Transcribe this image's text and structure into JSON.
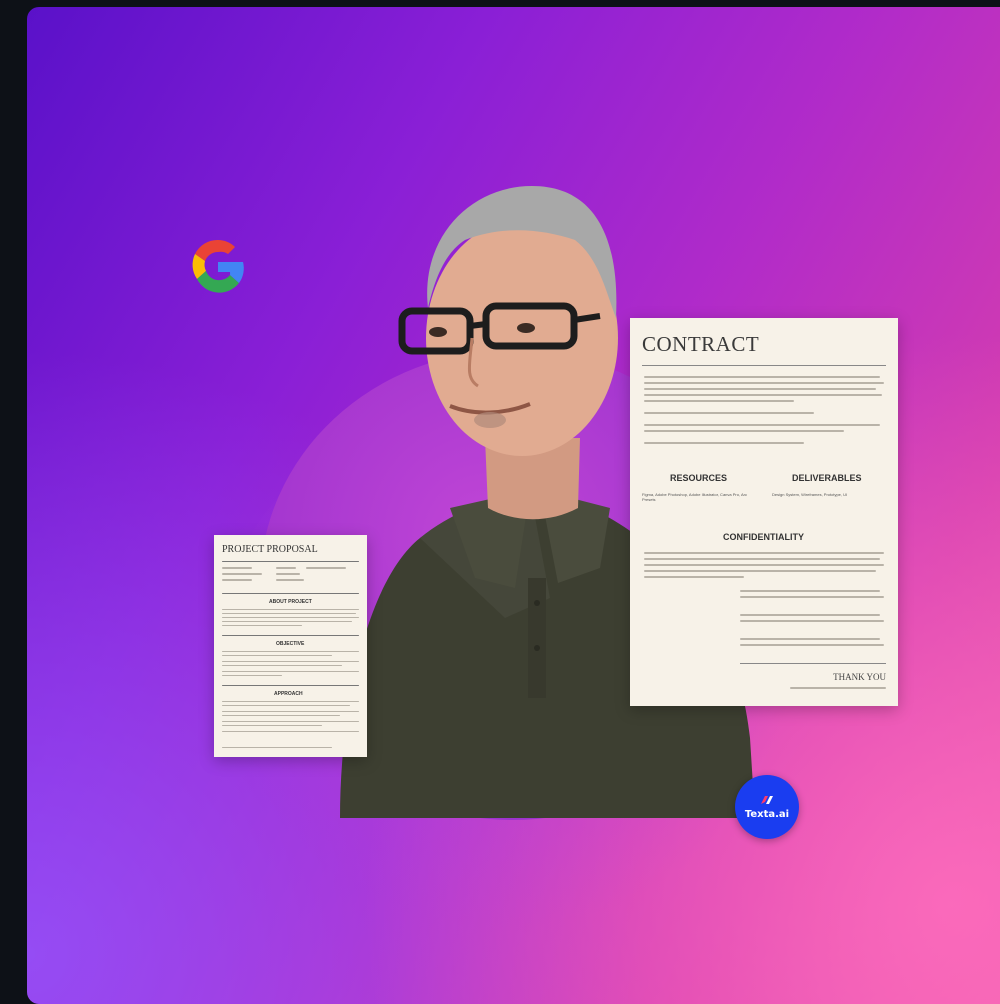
{
  "contract": {
    "title": "CONTRACT",
    "resources_heading": "RESOURCES",
    "resources_text": "Figma, Adobe Photoshop, Adobe Illustrator, Canva Pro, Arc Presets",
    "deliverables_heading": "DELIVERABLES",
    "deliverables_text": "Design System, Wireframes, Prototype, UI",
    "confidentiality_heading": "CONFIDENTIALITY",
    "signature": "THANK YOU"
  },
  "proposal": {
    "title": "PROJECT PROPOSAL",
    "about_heading": "ABOUT PROJECT",
    "objective_heading": "OBJECTIVE",
    "approach_heading": "APPROACH"
  },
  "badge": {
    "label": "Texta.ai"
  },
  "icons": {
    "google": "google-g-logo",
    "texta": "texta-logo"
  },
  "colors": {
    "accent": "#1a3df0",
    "gradient_start": "#5a11c9",
    "gradient_end": "#e95aa8"
  }
}
